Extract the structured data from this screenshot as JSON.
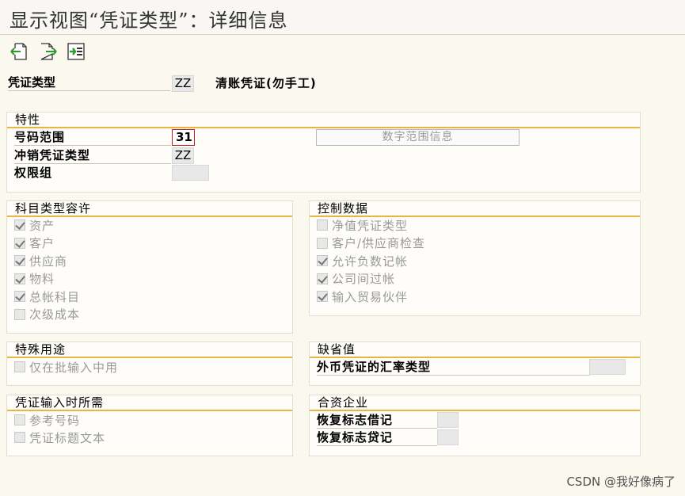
{
  "window": {
    "title": "显示视图“凭证类型”：详细信息"
  },
  "toolbar": {
    "buttons": [
      {
        "name": "previous-entry",
        "icon": "arrow-left-page-icon"
      },
      {
        "name": "next-entry",
        "icon": "arrow-right-page-icon"
      },
      {
        "name": "select-other",
        "icon": "select-list-icon"
      }
    ],
    "accent": "#2e9a2e"
  },
  "header": {
    "label": "凭证类型",
    "value": "ZZ",
    "description": "清账凭证(勿手工)"
  },
  "properties": {
    "title": "特性",
    "number_range": {
      "label": "号码范围",
      "value": "31"
    },
    "reverse_doc_type": {
      "label": "冲销凭证类型",
      "value": "ZZ"
    },
    "authorization_group": {
      "label": "权限组",
      "value": ""
    },
    "number_range_info_button": "数字范围信息"
  },
  "account_types": {
    "title": "科目类型容许",
    "items": [
      {
        "label": "资产",
        "checked": true
      },
      {
        "label": "客户",
        "checked": true
      },
      {
        "label": "供应商",
        "checked": true
      },
      {
        "label": "物料",
        "checked": true
      },
      {
        "label": "总帐科目",
        "checked": true
      },
      {
        "label": "次级成本",
        "checked": false
      }
    ]
  },
  "control_data": {
    "title": "控制数据",
    "items": [
      {
        "label": "净值凭证类型",
        "checked": false
      },
      {
        "label": "客户/供应商检查",
        "checked": false
      },
      {
        "label": "允许负数记帐",
        "checked": true
      },
      {
        "label": "公司间过帐",
        "checked": true
      },
      {
        "label": "输入贸易伙伴",
        "checked": true
      }
    ]
  },
  "special_usage": {
    "title": "特殊用途",
    "items": [
      {
        "label": "仅在批输入中用",
        "checked": false
      }
    ]
  },
  "defaults": {
    "title": "缺省值",
    "exchange_rate_type": {
      "label": "外币凭证的汇率类型",
      "value": ""
    }
  },
  "required_input": {
    "title": "凭证输入时所需",
    "items": [
      {
        "label": "参考号码",
        "checked": false
      },
      {
        "label": "凭证标题文本",
        "checked": false
      }
    ]
  },
  "joint_venture": {
    "title": "合资企业",
    "debit_recovery": {
      "label": "恢复标志借记",
      "value": ""
    },
    "credit_recovery": {
      "label": "恢复标志贷记",
      "value": ""
    }
  },
  "watermark": "CSDN @我好像病了",
  "colors": {
    "group_title_underline": "#e8b442",
    "background": "#fbf8f0"
  }
}
